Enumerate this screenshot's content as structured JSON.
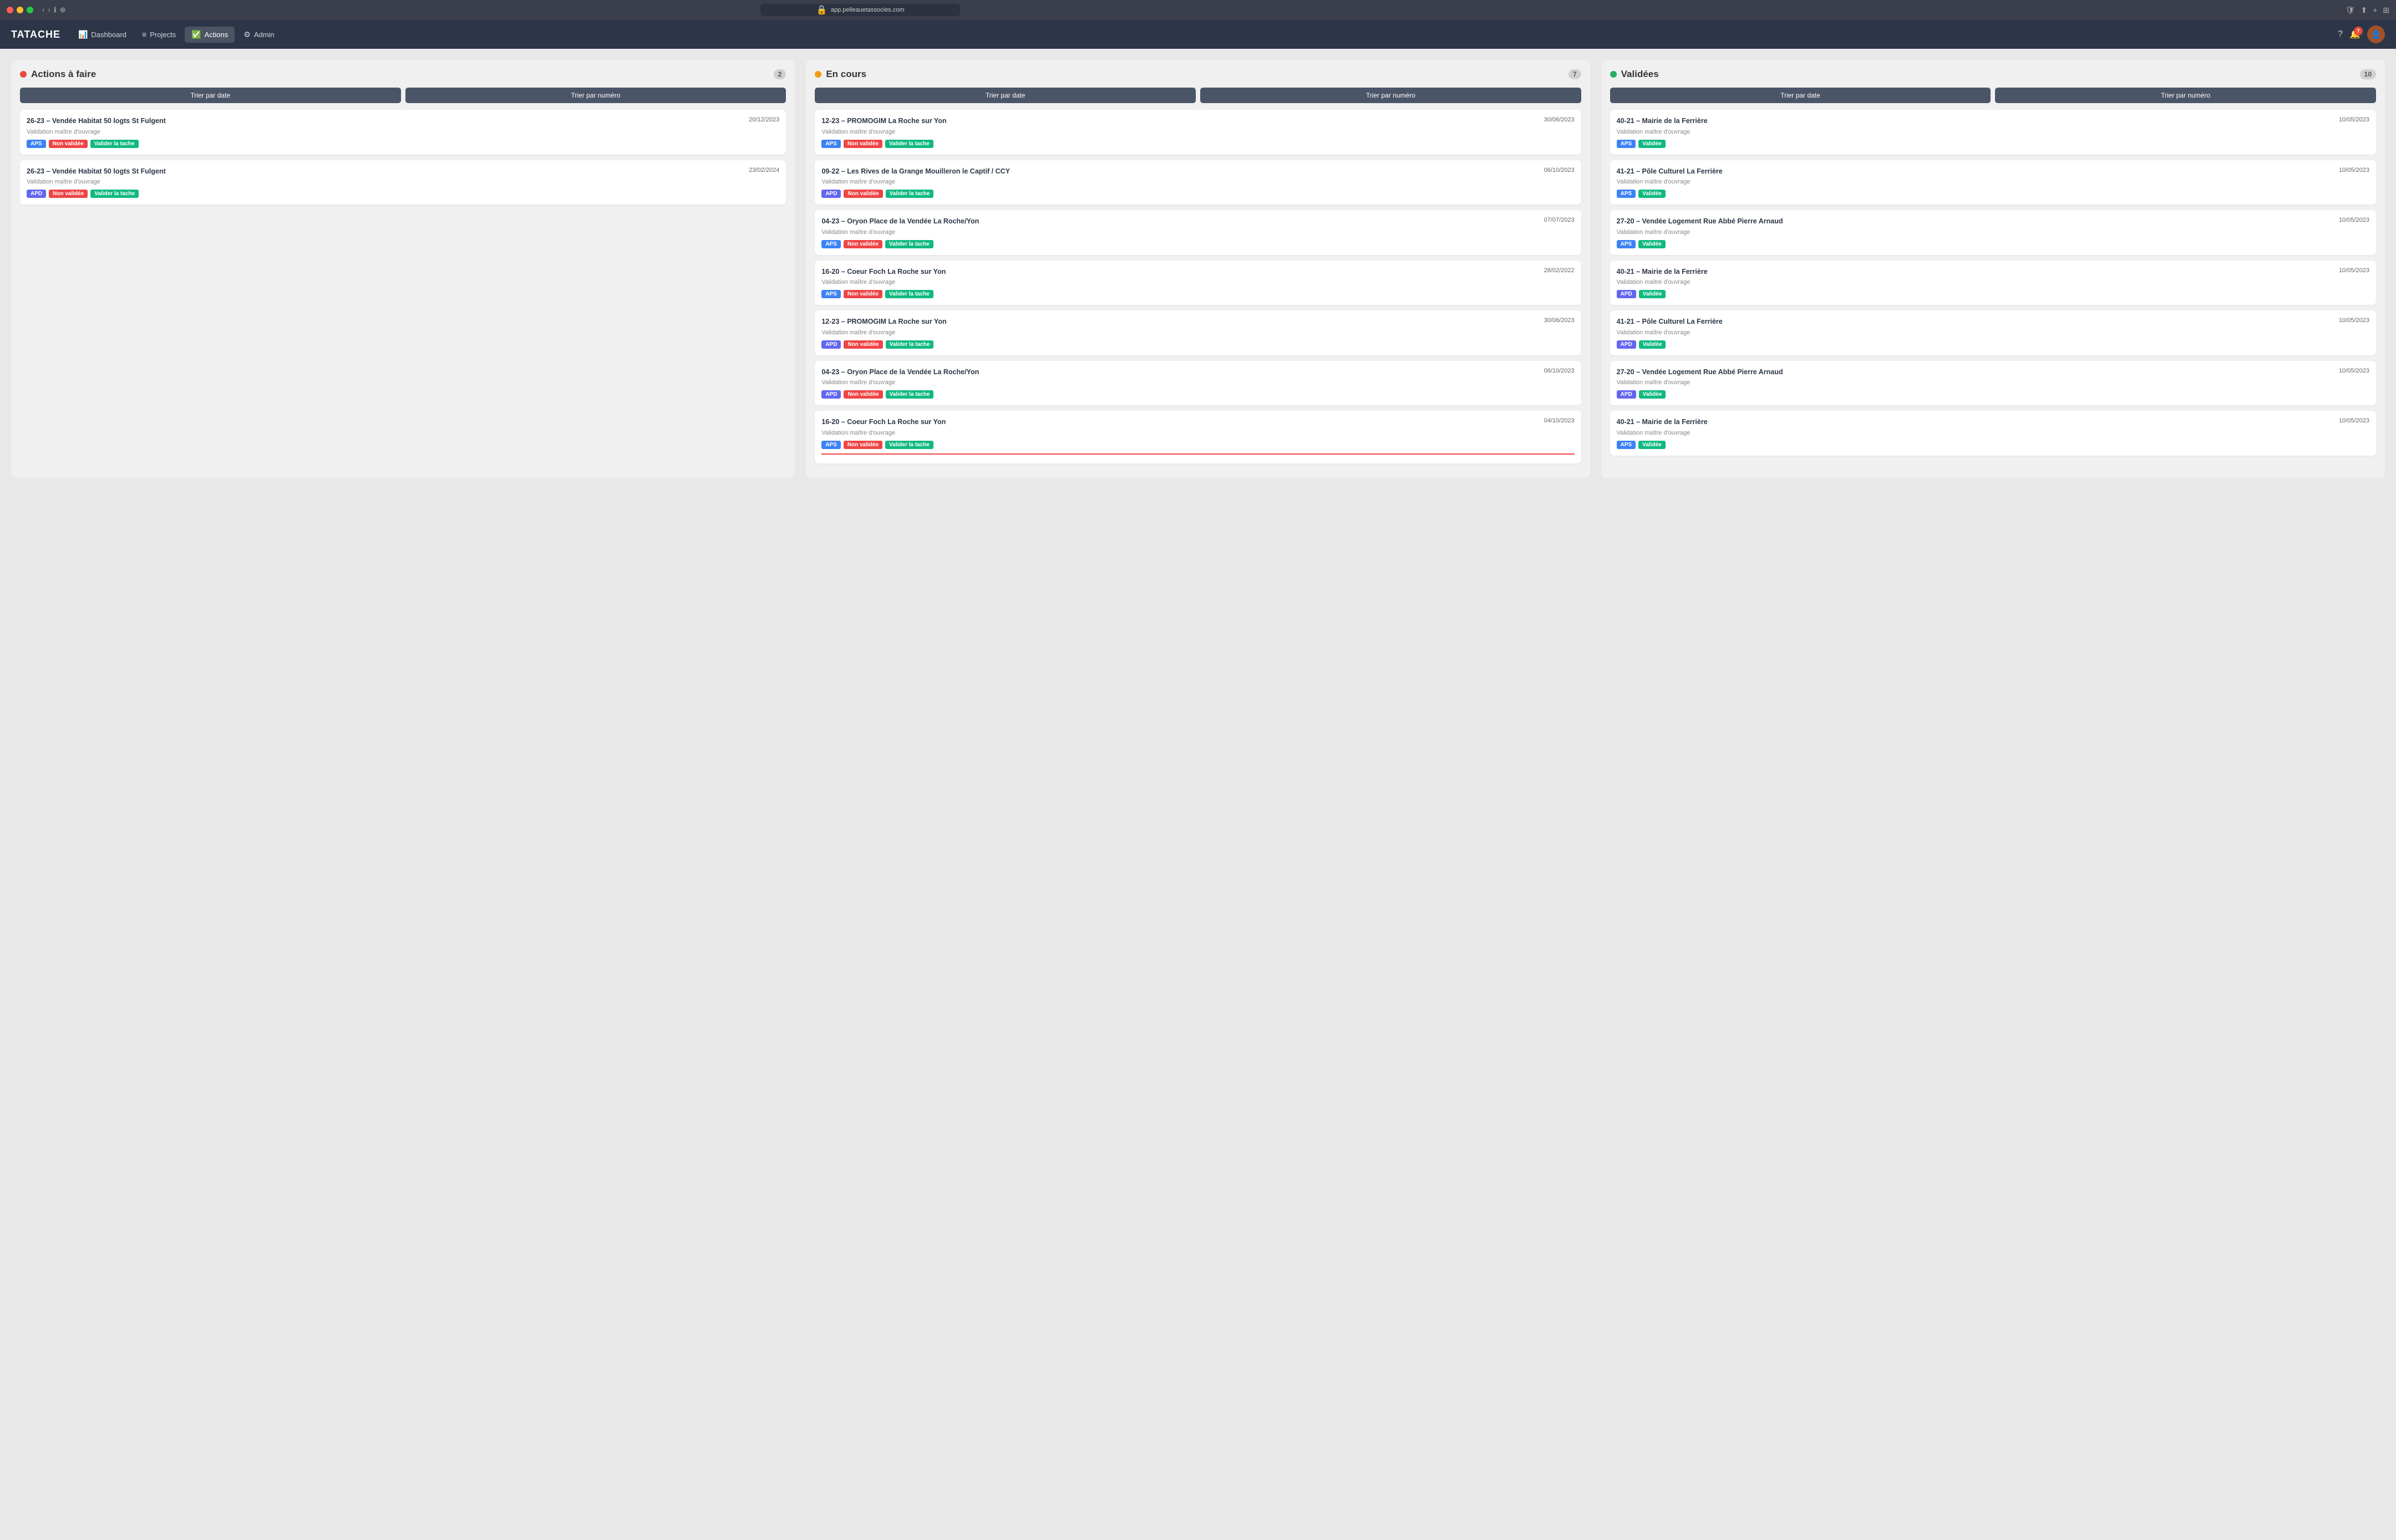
{
  "browser": {
    "url": "app.pelleauetassocies.com",
    "shield_icon": "🛡",
    "share_icon": "⬆",
    "plus_icon": "+",
    "grid_icon": "⊞"
  },
  "nav": {
    "logo": "TATACHE",
    "items": [
      {
        "id": "dashboard",
        "label": "Dashboard",
        "icon": "📊",
        "active": false
      },
      {
        "id": "projects",
        "label": "Projects",
        "icon": "≡",
        "active": false
      },
      {
        "id": "actions",
        "label": "Actions",
        "icon": "✅",
        "active": true
      },
      {
        "id": "admin",
        "label": "Admin",
        "icon": "⚙",
        "active": false
      }
    ],
    "help_icon": "?",
    "notification_count": "7",
    "avatar_letter": "👤"
  },
  "columns": [
    {
      "id": "todo",
      "title": "Actions à faire",
      "dot_class": "col-dot-red",
      "count": "2",
      "sort_date_label": "Trier par date",
      "sort_num_label": "Trier par numéro",
      "cards": [
        {
          "title": "26-23 – Vendée Habitat 50 logts St Fulgent",
          "subtitle": "Validation maître d'ouvrage",
          "date": "20/12/2023",
          "phase": "APS",
          "phase_class": "tag-phase",
          "status": "Non validée",
          "action": "Valider la tache",
          "bottom_class": ""
        },
        {
          "title": "26-23 – Vendée Habitat 50 logts St Fulgent",
          "subtitle": "Validation maître d'ouvrage",
          "date": "23/02/2024",
          "phase": "APD",
          "phase_class": "tag-phase-apd",
          "status": "Non validée",
          "action": "Valider la tache",
          "bottom_class": ""
        }
      ]
    },
    {
      "id": "in_progress",
      "title": "En cours",
      "dot_class": "col-dot-orange",
      "count": "7",
      "sort_date_label": "Trier par date",
      "sort_num_label": "Trier par numéro",
      "cards": [
        {
          "title": "12-23 – PROMOGIM La Roche sur Yon",
          "subtitle": "Validation maître d'ouvrage",
          "date": "30/06/2023",
          "phase": "APS",
          "phase_class": "tag-phase",
          "status": "Non validée",
          "action": "Valider la tache",
          "bottom_class": ""
        },
        {
          "title": "09-22 – Les Rives de la Grange Mouilleron le Captif / CCY",
          "subtitle": "Validation maître d'ouvrage",
          "date": "06/10/2023",
          "phase": "APD",
          "phase_class": "tag-phase-apd",
          "status": "Non validée",
          "action": "Valider la tache",
          "bottom_class": ""
        },
        {
          "title": "04-23 – Oryon Place de la Vendée La Roche/Yon",
          "subtitle": "Validation maître d'ouvrage",
          "date": "07/07/2023",
          "phase": "APS",
          "phase_class": "tag-phase",
          "status": "Non validée",
          "action": "Valider la tache",
          "bottom_class": ""
        },
        {
          "title": "16-20 – Coeur Foch La Roche sur Yon",
          "subtitle": "Validation maître d'ouvrage",
          "date": "28/02/2022",
          "phase": "APS",
          "phase_class": "tag-phase",
          "status": "Non validée",
          "action": "Valider la tache",
          "bottom_class": ""
        },
        {
          "title": "12-23 – PROMOGIM La Roche sur Yon",
          "subtitle": "Validation maître d'ouvrage",
          "date": "30/06/2023",
          "phase": "APD",
          "phase_class": "tag-phase-apd",
          "status": "Non validée",
          "action": "Valider la tache",
          "bottom_class": ""
        },
        {
          "title": "04-23 – Oryon Place de la Vendée La Roche/Yon",
          "subtitle": "Validation maître d'ouvrage",
          "date": "06/10/2023",
          "phase": "APD",
          "phase_class": "tag-phase-apd",
          "status": "Non validée",
          "action": "Valider la tache",
          "bottom_class": ""
        },
        {
          "title": "16-20 – Coeur Foch La Roche sur Yon",
          "subtitle": "Validation maître d'ouvrage",
          "date": "04/10/2023",
          "phase": "APS",
          "phase_class": "tag-phase",
          "status": "Non validée",
          "action": "Valider la tache",
          "bottom_class": "card-bottom-red"
        }
      ]
    },
    {
      "id": "validated",
      "title": "Validées",
      "dot_class": "col-dot-green",
      "count": "10",
      "sort_date_label": "Trier par date",
      "sort_num_label": "Trier par numéro",
      "cards": [
        {
          "title": "40-21 – Mairie de la Ferrière",
          "subtitle": "Validation maître d'ouvrage",
          "date": "10/05/2023",
          "phase": "APS",
          "phase_class": "tag-phase",
          "status": "Validée",
          "action": null,
          "bottom_class": ""
        },
        {
          "title": "41-21 – Pôle Culturel La Ferrière",
          "subtitle": "Validation maître d'ouvrage",
          "date": "10/05/2023",
          "phase": "APS",
          "phase_class": "tag-phase",
          "status": "Validée",
          "action": null,
          "bottom_class": ""
        },
        {
          "title": "27-20 – Vendée Logement Rue Abbé Pierre Arnaud",
          "subtitle": "Validation maître d'ouvrage",
          "date": "10/05/2023",
          "phase": "APS",
          "phase_class": "tag-phase",
          "status": "Validée",
          "action": null,
          "bottom_class": ""
        },
        {
          "title": "40-21 – Mairie de la Ferrière",
          "subtitle": "Validation maître d'ouvrage",
          "date": "10/05/2023",
          "phase": "APD",
          "phase_class": "tag-phase-apd",
          "status": "Validée",
          "action": null,
          "bottom_class": ""
        },
        {
          "title": "41-21 – Pôle Culturel La Ferrière",
          "subtitle": "Validation maître d'ouvrage",
          "date": "10/05/2023",
          "phase": "APD",
          "phase_class": "tag-phase-apd",
          "status": "Validée",
          "action": null,
          "bottom_class": ""
        },
        {
          "title": "27-20 – Vendée Logement Rue Abbé Pierre Arnaud",
          "subtitle": "Validation maître d'ouvrage",
          "date": "10/05/2023",
          "phase": "APD",
          "phase_class": "tag-phase-apd",
          "status": "Validée",
          "action": null,
          "bottom_class": ""
        },
        {
          "title": "40-21 – Mairie de la Ferrière",
          "subtitle": "Validation maître d'ouvrage",
          "date": "10/05/2023",
          "phase": "APS",
          "phase_class": "tag-phase",
          "status": "Validée",
          "action": null,
          "bottom_class": ""
        }
      ]
    }
  ]
}
